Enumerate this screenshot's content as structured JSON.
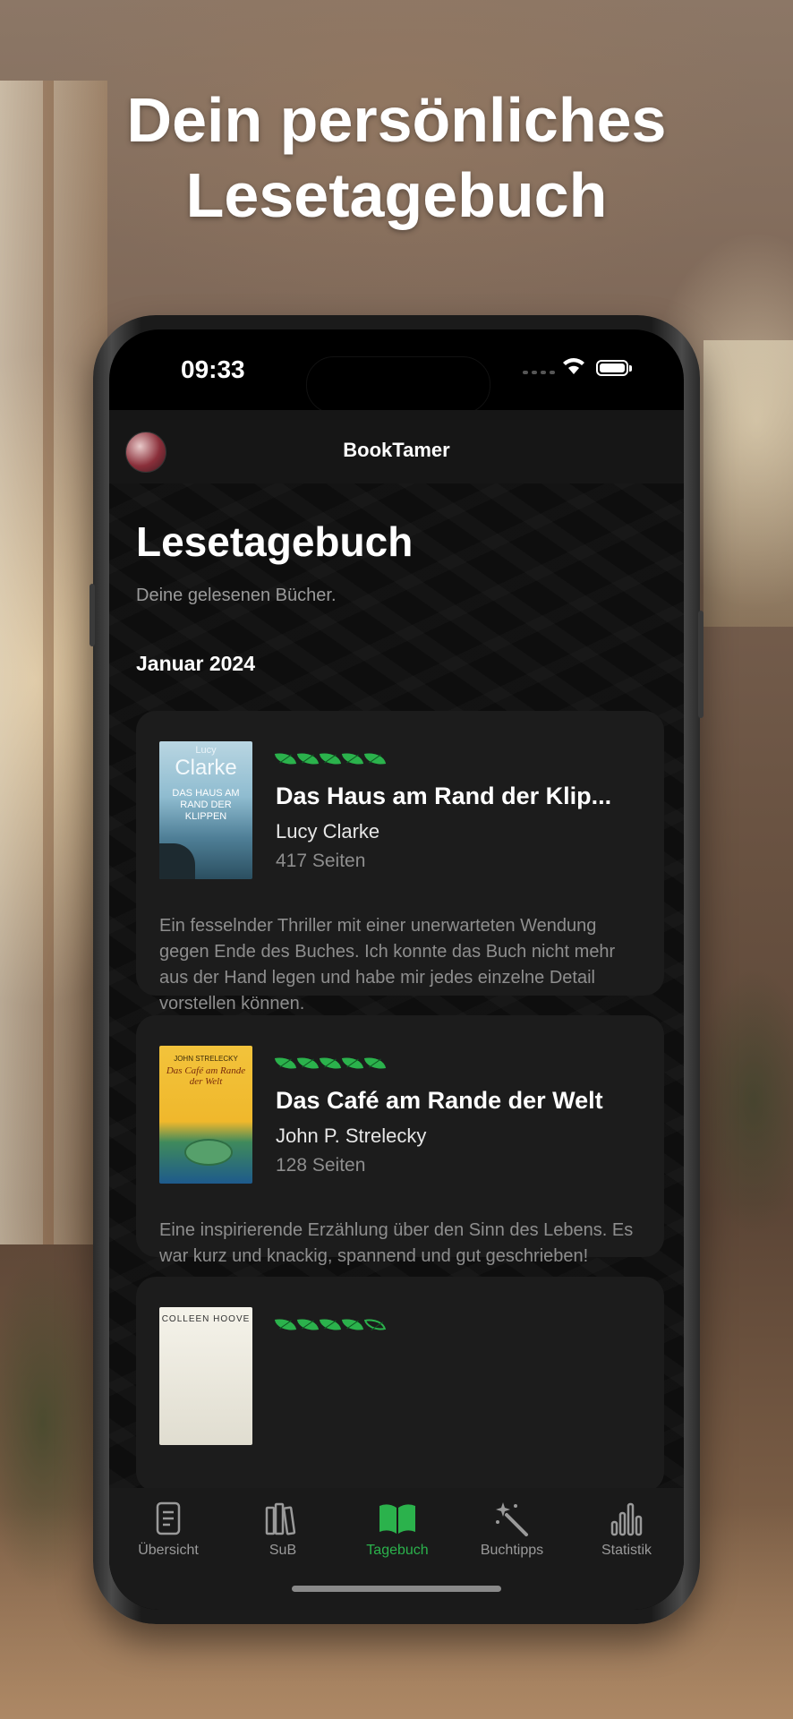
{
  "headline": {
    "line1": "Dein persönliches",
    "line2": "Lesetagebuch"
  },
  "status_bar": {
    "time": "09:33"
  },
  "nav": {
    "title": "BookTamer"
  },
  "page": {
    "title": "Lesetagebuch",
    "subtitle": "Deine gelesenen Bücher.",
    "month": "Januar 2024"
  },
  "books": [
    {
      "title": "Das Haus am Rand der Klip...",
      "author": "Lucy Clarke",
      "pages": "417 Seiten",
      "rating": 5,
      "review": "Ein fesselnder Thriller mit einer unerwarteten Wendung gegen Ende des Buches. Ich konnte das Buch nicht mehr aus der Hand legen und habe mir jedes einzelne Detail vorstellen können.",
      "cover": {
        "author_small": "Lucy",
        "author_large": "Clarke",
        "title_lines": "DAS HAUS AM RAND DER KLIPPEN"
      }
    },
    {
      "title": "Das Café am Rande der Welt",
      "author": "John P. Strelecky",
      "pages": "128 Seiten",
      "rating": 5,
      "review": "Eine inspirierende Erzählung über den Sinn des Lebens. Es war kurz und knackig, spannend und gut geschrieben!",
      "cover": {
        "author_small": "JOHN STRELECKY",
        "title_lines": "Das Café am Rande der Welt"
      }
    },
    {
      "rating": 4.5,
      "cover": {
        "author_small": "COLLEEN HOOVE"
      }
    }
  ],
  "tabs": [
    {
      "label": "Übersicht",
      "icon": "document-icon",
      "active": false
    },
    {
      "label": "SuB",
      "icon": "books-stack-icon",
      "active": false
    },
    {
      "label": "Tagebuch",
      "icon": "open-book-icon",
      "active": true
    },
    {
      "label": "Buchtipps",
      "icon": "magic-wand-icon",
      "active": false
    },
    {
      "label": "Statistik",
      "icon": "bar-chart-icon",
      "active": false
    }
  ],
  "colors": {
    "accent": "#2bb24c",
    "card_bg": "#1c1c1c",
    "screen_bg": "#0e0e0e"
  }
}
